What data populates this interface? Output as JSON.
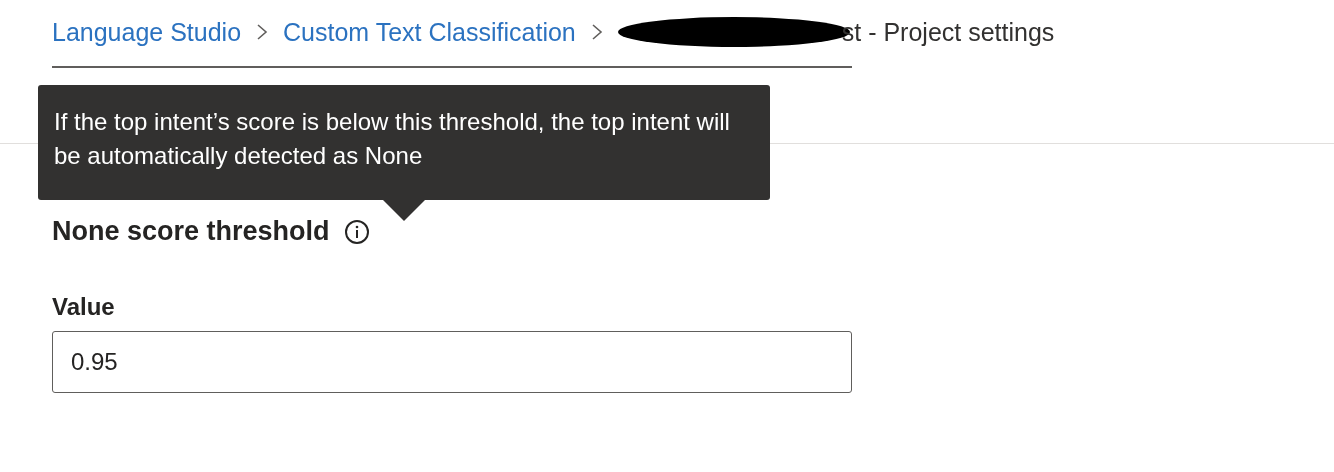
{
  "breadcrumb": [
    {
      "label": "Language Studio",
      "kind": "link"
    },
    {
      "label": "Custom Text Classification",
      "kind": "link"
    },
    {
      "label": "st - Project settings",
      "kind": "current"
    }
  ],
  "tooltip": {
    "text": "If the top intent’s score is below this threshold, the top intent will be automatically detected as None"
  },
  "setting": {
    "title": "None score threshold",
    "field_label": "Value",
    "value": "0.95"
  }
}
